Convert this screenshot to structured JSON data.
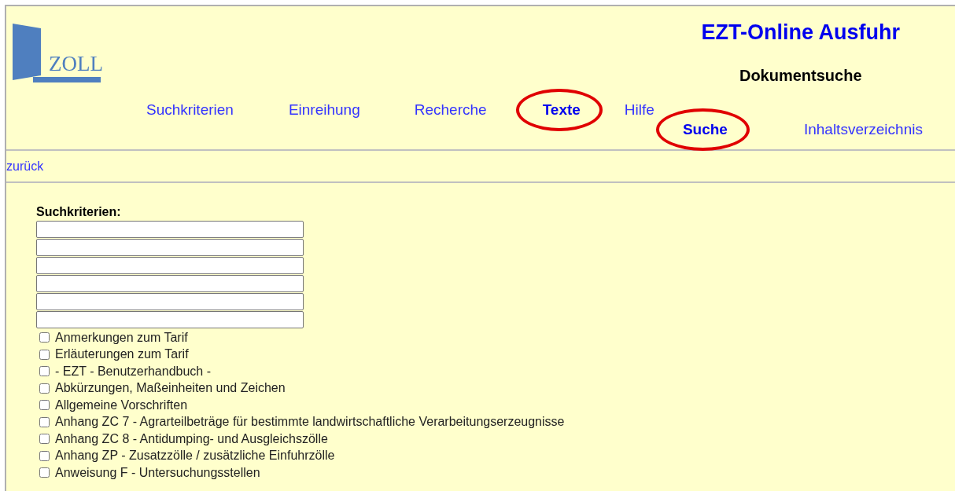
{
  "header": {
    "logo_text": "ZOLL",
    "title": "EZT-Online Ausfuhr",
    "subtitle": "Dokumentsuche"
  },
  "nav": [
    {
      "label": "Suchkriterien",
      "selected": false,
      "circled": false
    },
    {
      "label": "Einreihung",
      "selected": false,
      "circled": false
    },
    {
      "label": "Recherche",
      "selected": false,
      "circled": false
    },
    {
      "label": "Texte",
      "selected": true,
      "circled": true
    },
    {
      "label": "Hilfe",
      "selected": false,
      "circled": false
    },
    {
      "label": "Suche",
      "selected": true,
      "circled": true
    },
    {
      "label": "Inhaltsverzeichnis",
      "selected": false,
      "circled": false
    }
  ],
  "back_link": "zurück",
  "search": {
    "label": "Suchkriterien:"
  },
  "documents": [
    {
      "label": "Anmerkungen zum Tarif",
      "checked": false
    },
    {
      "label": "Erläuterungen zum Tarif",
      "checked": false
    },
    {
      "label": "- EZT - Benutzerhandbuch -",
      "checked": false
    },
    {
      "label": "Abkürzungen, Maßeinheiten und Zeichen",
      "checked": false
    },
    {
      "label": "Allgemeine Vorschriften",
      "checked": false
    },
    {
      "label": "Anhang ZC 7 - Agrarteilbeträge für bestimmte landwirtschaftliche Verarbeitungserzeugnisse",
      "checked": false
    },
    {
      "label": "Anhang ZC 8 - Antidumping- und Ausgleichszölle",
      "checked": false
    },
    {
      "label": "Anhang ZP - Zusatzzölle / zusätzliche Einfuhrzölle",
      "checked": false
    },
    {
      "label": "Anweisung F - Untersuchungsstellen",
      "checked": false
    }
  ]
}
